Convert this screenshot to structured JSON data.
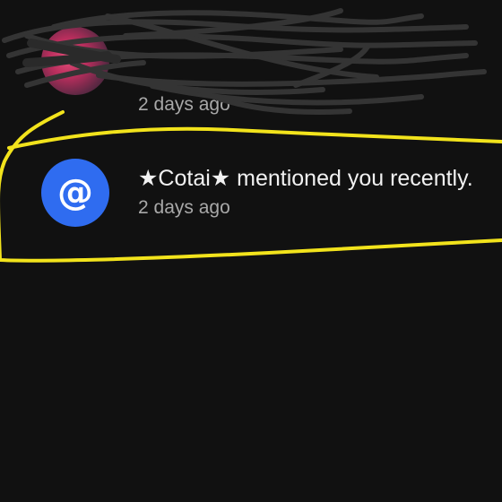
{
  "notifications": [
    {
      "title": "",
      "subtitle": "",
      "time": "2 days ago",
      "avatar_icon": "redacted-avatar"
    },
    {
      "title": "★Cotai★ mentioned you recently.",
      "time": "2 days ago",
      "avatar_icon": "at-mention-icon",
      "avatar_symbol": "@",
      "avatar_color": "#2f6cf0"
    }
  ],
  "highlight_color": "#f2e31c",
  "scribble_color": "#343434"
}
